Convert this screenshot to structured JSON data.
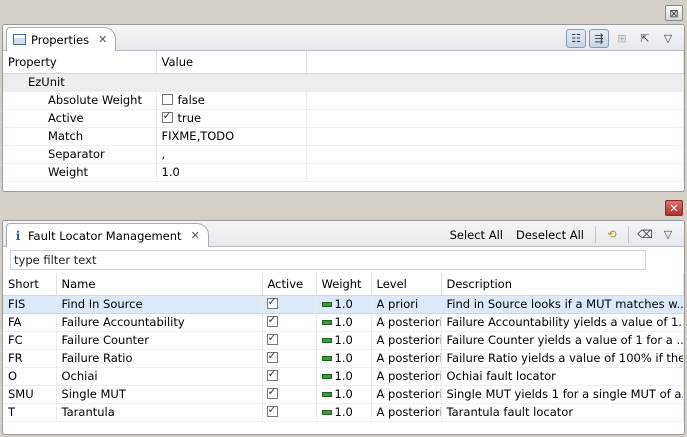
{
  "properties_view": {
    "tab_label": "Properties",
    "close_symbol": "✕",
    "columns": [
      "Property",
      "Value"
    ],
    "category": "EzUnit",
    "rows": [
      {
        "property": "Absolute Weight",
        "checkbox": true,
        "checked": false,
        "value": "false"
      },
      {
        "property": "Active",
        "checkbox": true,
        "checked": true,
        "value": "true"
      },
      {
        "property": "Match",
        "checkbox": false,
        "value": "FIXME,TODO"
      },
      {
        "property": "Separator",
        "checkbox": false,
        "value": ","
      },
      {
        "property": "Weight",
        "checkbox": false,
        "value": "1.0"
      }
    ]
  },
  "fault_locator_view": {
    "tab_label": "Fault Locator Management",
    "close_symbol": "✕",
    "select_all": "Select All",
    "deselect_all": "Deselect All",
    "filter_placeholder": "type filter text",
    "columns": [
      "Short",
      "Name",
      "Active",
      "Weight",
      "Level",
      "Description"
    ],
    "rows": [
      {
        "short": "FIS",
        "name": "Find In Source",
        "active": true,
        "weight": "1.0",
        "level": "A priori",
        "description": "Find in Source looks if a MUT matches w...",
        "selected": true
      },
      {
        "short": "FA",
        "name": "Failure Accountability",
        "active": true,
        "weight": "1.0",
        "level": "A posteriori",
        "description": "Failure Accountability yields a value of 1...",
        "selected": false
      },
      {
        "short": "FC",
        "name": "Failure Counter",
        "active": true,
        "weight": "1.0",
        "level": "A posteriori",
        "description": "Failure Counter yields a value of 1 for a ...",
        "selected": false
      },
      {
        "short": "FR",
        "name": "Failure Ratio",
        "active": true,
        "weight": "1.0",
        "level": "A posteriori",
        "description": "Failure Ratio yields a value of 100% if the ...",
        "selected": false
      },
      {
        "short": "O",
        "name": "Ochiai",
        "active": true,
        "weight": "1.0",
        "level": "A posteriori",
        "description": "Ochiai fault locator",
        "selected": false
      },
      {
        "short": "SMU",
        "name": "Single MUT",
        "active": true,
        "weight": "1.0",
        "level": "A posteriori",
        "description": "Single MUT yields 1 for a single MUT of a...",
        "selected": false
      },
      {
        "short": "T",
        "name": "Tarantula",
        "active": true,
        "weight": "1.0",
        "level": "A posteriori",
        "description": "Tarantula fault locator",
        "selected": false
      }
    ]
  },
  "icons": {
    "view_menu": "▽",
    "minimize": "⊠",
    "refresh": "⟲",
    "clear": "⌫",
    "categories": "☷",
    "filter": "⇶",
    "advanced": "⊞",
    "pin": "⇱"
  },
  "colors": {
    "selection": "#dce9f8",
    "weight_bar": "#3c9a3c",
    "close_button": "#c04040"
  }
}
